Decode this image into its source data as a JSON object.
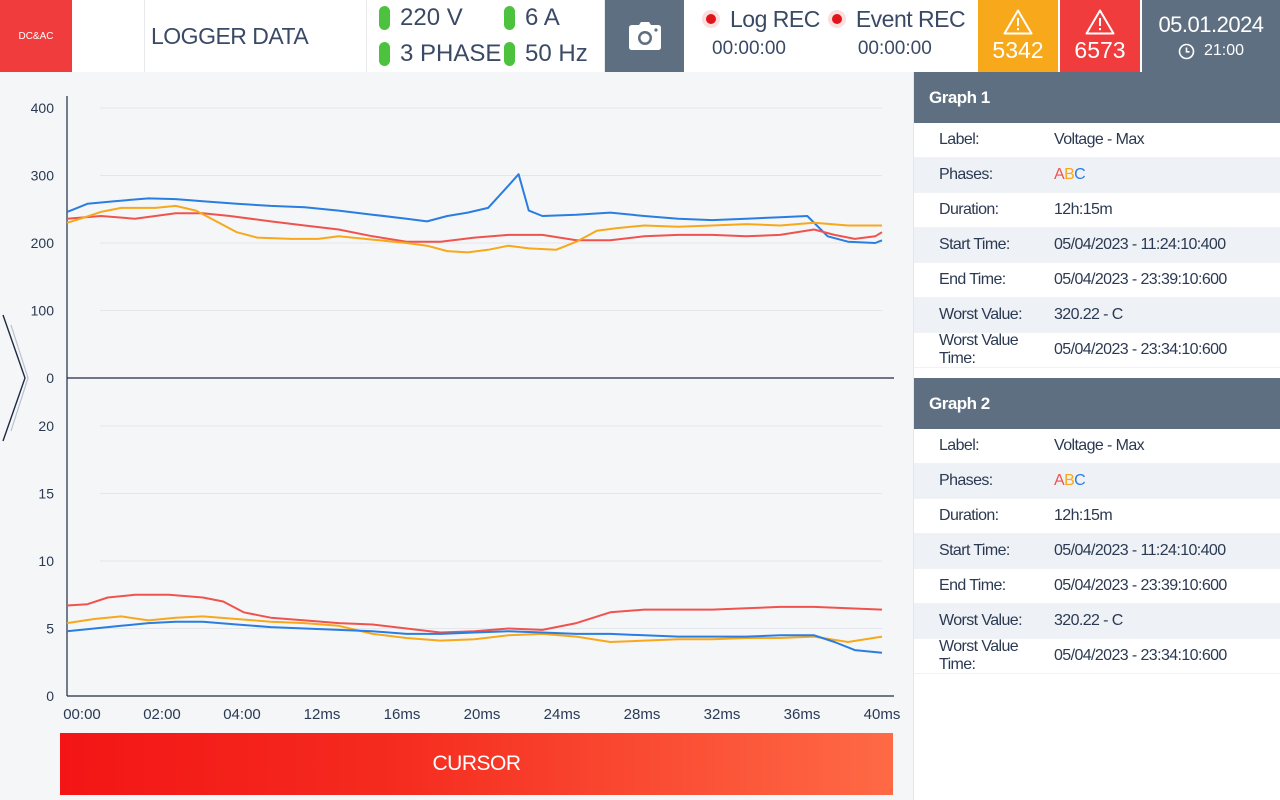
{
  "header": {
    "logo_text": "DC&AC",
    "title": "LOGGER DATA",
    "status": {
      "voltage": "220 V",
      "current": "6 A",
      "phase": "3 PHASE",
      "frequency": "50 Hz"
    },
    "log_rec": {
      "label": "Log REC",
      "time": "00:00:00"
    },
    "event_rec": {
      "label": "Event REC",
      "time": "00:00:00"
    },
    "warning_count": "5342",
    "alarm_count": "6573",
    "date": "05.01.2024",
    "time": "21:00"
  },
  "colors": {
    "phase_a": "#f0534e",
    "phase_b": "#f7a81b",
    "phase_c": "#2a7de1",
    "accent_red": "#f03c3c",
    "warning": "#f7a81b",
    "header_gray": "#5f6f82",
    "status_green": "#4cc23e"
  },
  "cursor_label": "CURSOR",
  "graphs": [
    {
      "heading": "Graph 1",
      "rows": [
        {
          "label": "Label:",
          "value": "Voltage - Max"
        },
        {
          "label": "Phases:",
          "value": ""
        },
        {
          "label": "Duration:",
          "value": "12h:15m"
        },
        {
          "label": "Start Time:",
          "value": "05/04/2023  - 11:24:10:400"
        },
        {
          "label": "End Time:",
          "value": "05/04/2023  - 23:39:10:600"
        },
        {
          "label": "Worst Value:",
          "value": "320.22 - C"
        },
        {
          "label": "Worst Value Time:",
          "value": "05/04/2023  - 23:34:10:600"
        }
      ],
      "phases": [
        "A",
        "B",
        "C"
      ]
    },
    {
      "heading": "Graph 2",
      "rows": [
        {
          "label": "Label:",
          "value": "Voltage - Max"
        },
        {
          "label": "Phases:",
          "value": ""
        },
        {
          "label": "Duration:",
          "value": "12h:15m"
        },
        {
          "label": "Start Time:",
          "value": "05/04/2023  - 11:24:10:400"
        },
        {
          "label": "End Time:",
          "value": "05/04/2023  - 23:39:10:600"
        },
        {
          "label": "Worst Value:",
          "value": "320.22 - C"
        },
        {
          "label": "Worst Value Time:",
          "value": "05/04/2023  - 23:34:10:600"
        }
      ],
      "phases": [
        "A",
        "B",
        "C"
      ]
    }
  ],
  "chart_data": [
    {
      "type": "line",
      "categories": [
        "00:00",
        "02:00",
        "04:00",
        "12ms",
        "16ms",
        "20ms",
        "24ms",
        "28ms",
        "32ms",
        "36ms",
        "40ms"
      ],
      "ylim": [
        0,
        400
      ],
      "yticks": [
        0,
        100,
        200,
        300,
        400
      ],
      "grid": true,
      "series": [
        {
          "phase": "C",
          "color": "#2a7de1",
          "values": [
            [
              0,
              246
            ],
            [
              0.1,
              250
            ],
            [
              0.3,
              258
            ],
            [
              0.7,
              262
            ],
            [
              1.2,
              266
            ],
            [
              1.6,
              265
            ],
            [
              2.0,
              262
            ],
            [
              2.5,
              258
            ],
            [
              3.0,
              255
            ],
            [
              3.5,
              253
            ],
            [
              4.0,
              248
            ],
            [
              4.5,
              242
            ],
            [
              5.0,
              236
            ],
            [
              5.3,
              232
            ],
            [
              5.6,
              240
            ],
            [
              5.9,
              245
            ],
            [
              6.2,
              252
            ],
            [
              6.5,
              285
            ],
            [
              6.65,
              302
            ],
            [
              6.8,
              248
            ],
            [
              7.0,
              240
            ],
            [
              7.5,
              242
            ],
            [
              8.0,
              245
            ],
            [
              8.5,
              240
            ],
            [
              9.0,
              236
            ],
            [
              9.5,
              234
            ],
            [
              10.0,
              236
            ],
            [
              10.5,
              238
            ],
            [
              10.9,
              240
            ],
            [
              11.2,
              210
            ],
            [
              11.5,
              202
            ],
            [
              11.9,
              200
            ],
            [
              12.0,
              204
            ]
          ]
        },
        {
          "phase": "A",
          "color": "#f0534e",
          "values": [
            [
              0,
              236
            ],
            [
              0.5,
              240
            ],
            [
              1.0,
              236
            ],
            [
              1.6,
              244
            ],
            [
              2.0,
              244
            ],
            [
              2.4,
              240
            ],
            [
              3.0,
              232
            ],
            [
              3.5,
              226
            ],
            [
              4.0,
              220
            ],
            [
              4.5,
              210
            ],
            [
              5.0,
              202
            ],
            [
              5.5,
              202
            ],
            [
              6.0,
              208
            ],
            [
              6.5,
              212
            ],
            [
              7.0,
              212
            ],
            [
              7.5,
              204
            ],
            [
              8.0,
              204
            ],
            [
              8.5,
              210
            ],
            [
              9.0,
              212
            ],
            [
              9.5,
              212
            ],
            [
              10.0,
              210
            ],
            [
              10.5,
              212
            ],
            [
              11.0,
              220
            ],
            [
              11.3,
              212
            ],
            [
              11.6,
              206
            ],
            [
              11.9,
              210
            ],
            [
              12.0,
              216
            ]
          ]
        },
        {
          "phase": "B",
          "color": "#f7a81b",
          "values": [
            [
              0,
              230
            ],
            [
              0.2,
              236
            ],
            [
              0.5,
              246
            ],
            [
              0.8,
              252
            ],
            [
              1.3,
              252
            ],
            [
              1.6,
              255
            ],
            [
              1.9,
              248
            ],
            [
              2.2,
              232
            ],
            [
              2.5,
              216
            ],
            [
              2.8,
              208
            ],
            [
              3.3,
              206
            ],
            [
              3.7,
              206
            ],
            [
              4.0,
              210
            ],
            [
              4.5,
              205
            ],
            [
              5.0,
              200
            ],
            [
              5.3,
              196
            ],
            [
              5.6,
              188
            ],
            [
              5.9,
              186
            ],
            [
              6.2,
              190
            ],
            [
              6.5,
              196
            ],
            [
              6.8,
              192
            ],
            [
              7.2,
              190
            ],
            [
              7.5,
              202
            ],
            [
              7.8,
              218
            ],
            [
              8.1,
              222
            ],
            [
              8.5,
              226
            ],
            [
              9.0,
              224
            ],
            [
              9.5,
              226
            ],
            [
              10.0,
              228
            ],
            [
              10.5,
              226
            ],
            [
              11.0,
              230
            ],
            [
              11.5,
              226
            ],
            [
              12.0,
              226
            ]
          ]
        }
      ]
    },
    {
      "type": "line",
      "categories": [
        "00:00",
        "02:00",
        "04:00",
        "12ms",
        "16ms",
        "20ms",
        "24ms",
        "28ms",
        "32ms",
        "36ms",
        "40ms"
      ],
      "ylim": [
        0,
        20
      ],
      "yticks": [
        0,
        5,
        10,
        15,
        20
      ],
      "grid": true,
      "series": [
        {
          "phase": "A",
          "color": "#f0534e",
          "values": [
            [
              0,
              6.7
            ],
            [
              0.3,
              6.8
            ],
            [
              0.6,
              7.3
            ],
            [
              1.0,
              7.5
            ],
            [
              1.5,
              7.5
            ],
            [
              2.0,
              7.3
            ],
            [
              2.3,
              7.0
            ],
            [
              2.6,
              6.2
            ],
            [
              3.0,
              5.8
            ],
            [
              3.5,
              5.6
            ],
            [
              4.0,
              5.4
            ],
            [
              4.5,
              5.3
            ],
            [
              5.0,
              5.0
            ],
            [
              5.5,
              4.7
            ],
            [
              6.0,
              4.8
            ],
            [
              6.5,
              5.0
            ],
            [
              7.0,
              4.9
            ],
            [
              7.5,
              5.4
            ],
            [
              8.0,
              6.2
            ],
            [
              8.5,
              6.4
            ],
            [
              9.0,
              6.4
            ],
            [
              9.5,
              6.4
            ],
            [
              10.0,
              6.5
            ],
            [
              10.5,
              6.6
            ],
            [
              11.0,
              6.6
            ],
            [
              11.5,
              6.5
            ],
            [
              12.0,
              6.4
            ]
          ]
        },
        {
          "phase": "B",
          "color": "#f7a81b",
          "values": [
            [
              0,
              5.4
            ],
            [
              0.4,
              5.7
            ],
            [
              0.8,
              5.9
            ],
            [
              1.2,
              5.6
            ],
            [
              1.6,
              5.8
            ],
            [
              2.0,
              5.9
            ],
            [
              2.5,
              5.7
            ],
            [
              3.0,
              5.5
            ],
            [
              3.5,
              5.4
            ],
            [
              4.0,
              5.2
            ],
            [
              4.5,
              4.6
            ],
            [
              5.0,
              4.3
            ],
            [
              5.5,
              4.1
            ],
            [
              6.0,
              4.2
            ],
            [
              6.5,
              4.5
            ],
            [
              7.0,
              4.6
            ],
            [
              7.5,
              4.4
            ],
            [
              8.0,
              4.0
            ],
            [
              8.5,
              4.1
            ],
            [
              9.0,
              4.2
            ],
            [
              9.5,
              4.2
            ],
            [
              10.0,
              4.3
            ],
            [
              10.5,
              4.3
            ],
            [
              11.0,
              4.4
            ],
            [
              11.5,
              4.0
            ],
            [
              12.0,
              4.4
            ]
          ]
        },
        {
          "phase": "C",
          "color": "#2a7de1",
          "values": [
            [
              0,
              4.8
            ],
            [
              0.4,
              5.0
            ],
            [
              0.8,
              5.2
            ],
            [
              1.2,
              5.4
            ],
            [
              1.6,
              5.5
            ],
            [
              2.0,
              5.5
            ],
            [
              2.5,
              5.3
            ],
            [
              3.0,
              5.1
            ],
            [
              3.5,
              5.0
            ],
            [
              4.0,
              4.9
            ],
            [
              4.5,
              4.8
            ],
            [
              5.0,
              4.6
            ],
            [
              5.5,
              4.6
            ],
            [
              6.0,
              4.7
            ],
            [
              6.5,
              4.8
            ],
            [
              7.0,
              4.7
            ],
            [
              7.5,
              4.6
            ],
            [
              8.0,
              4.6
            ],
            [
              8.5,
              4.5
            ],
            [
              9.0,
              4.4
            ],
            [
              9.5,
              4.4
            ],
            [
              10.0,
              4.4
            ],
            [
              10.5,
              4.5
            ],
            [
              11.0,
              4.5
            ],
            [
              11.3,
              4.0
            ],
            [
              11.6,
              3.4
            ],
            [
              12.0,
              3.2
            ]
          ]
        }
      ]
    }
  ]
}
